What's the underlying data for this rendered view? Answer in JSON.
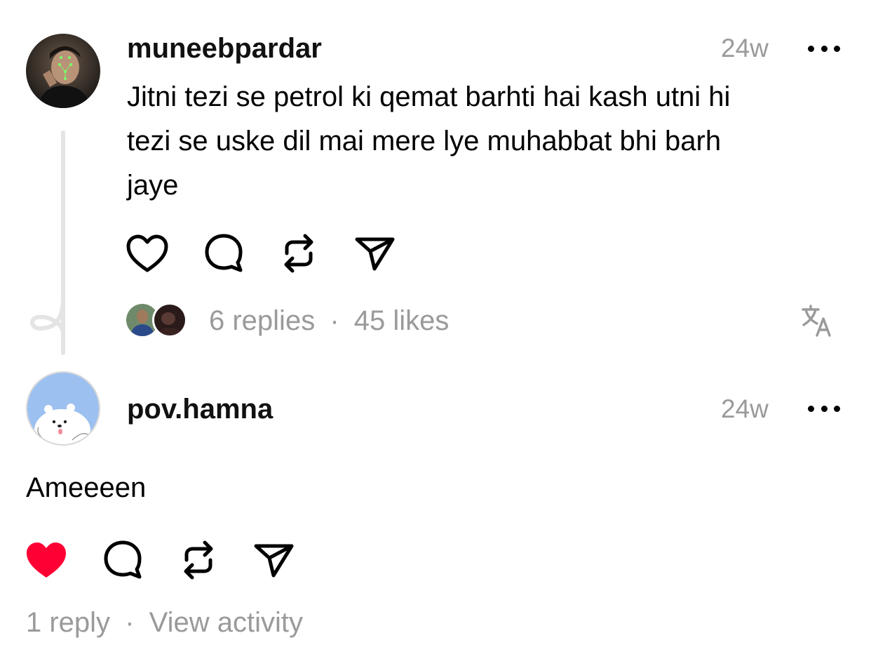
{
  "post": {
    "username": "muneebpardar",
    "timestamp": "24w",
    "text_line1": "Jitni tezi se petrol ki qemat barhti hai kash utni hi",
    "text_line2": "tezi se uske dil mai mere lye muhabbat bhi barh",
    "text_line3": "jaye",
    "replies": "6 replies",
    "separator": "·",
    "likes": "45 likes",
    "actions": [
      "heart-icon",
      "comment-icon",
      "repost-icon",
      "share-icon"
    ],
    "translate_icon": "translate-icon",
    "liked": false
  },
  "reply": {
    "username": "pov.hamna",
    "timestamp": "24w",
    "text": "Ameeeen",
    "replies": "1 reply",
    "separator": "·",
    "view_activity": "View activity",
    "actions": [
      "heart-filled-icon",
      "comment-icon",
      "repost-icon",
      "share-icon"
    ],
    "liked": true
  },
  "colors": {
    "like_red": "#ff0034",
    "muted_text": "#9a9a9a",
    "thread_line": "#e4e4e4",
    "avatar_blue": "#9cc0ef"
  }
}
